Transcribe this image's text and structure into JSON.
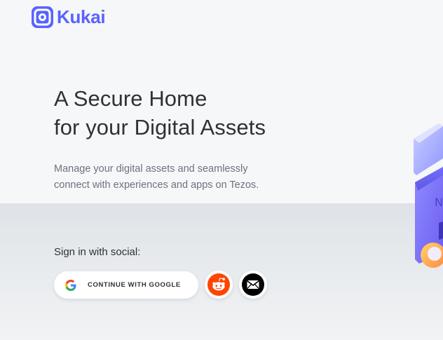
{
  "brand": {
    "name": "Kukai",
    "logo_icon": "kukai-logo-icon",
    "accent_color": "#5963ff"
  },
  "hero": {
    "title_line1": "A Secure Home",
    "title_line2": "for your Digital Assets",
    "subtitle_line1": "Manage your digital assets and seamlessly",
    "subtitle_line2": "connect with experiences and apps on Tezos."
  },
  "social": {
    "label": "Sign in with social:",
    "google_label": "CONTINUE WITH GOOGLE",
    "google_icon": "google-icon",
    "reddit_icon": "reddit-icon",
    "email_icon": "email-icon",
    "reddit_color": "#ff4500"
  }
}
